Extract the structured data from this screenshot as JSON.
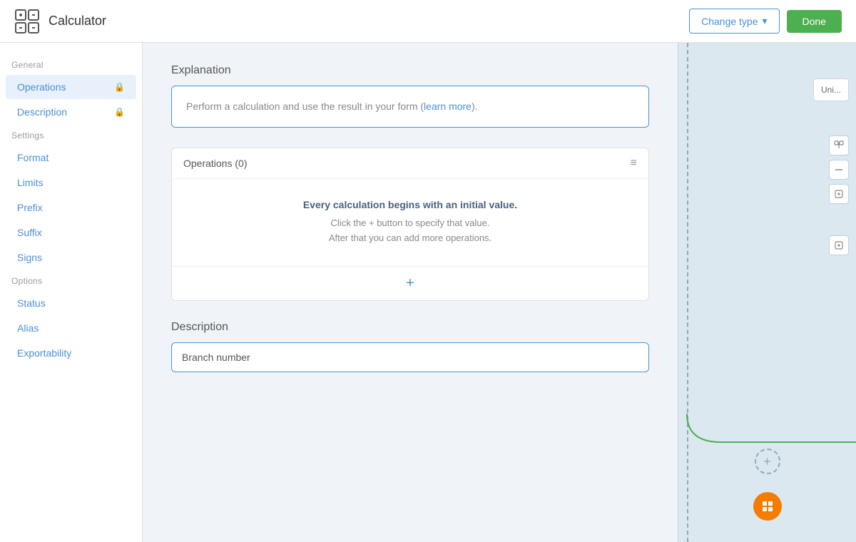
{
  "header": {
    "app_icon": "calculator-icon",
    "app_title": "Calculator",
    "change_type_label": "Change type",
    "done_label": "Done"
  },
  "sidebar": {
    "general_label": "General",
    "settings_label": "Settings",
    "options_label": "Options",
    "items_general": [
      {
        "id": "operations",
        "label": "Operations",
        "locked": true,
        "active": true
      },
      {
        "id": "description",
        "label": "Description",
        "locked": true,
        "active": false
      }
    ],
    "items_settings": [
      {
        "id": "format",
        "label": "Format",
        "locked": false
      },
      {
        "id": "limits",
        "label": "Limits",
        "locked": false
      },
      {
        "id": "prefix",
        "label": "Prefix",
        "locked": false
      },
      {
        "id": "suffix",
        "label": "Suffix",
        "locked": false
      },
      {
        "id": "signs",
        "label": "Signs",
        "locked": false
      }
    ],
    "items_options": [
      {
        "id": "status",
        "label": "Status",
        "locked": false
      },
      {
        "id": "alias",
        "label": "Alias",
        "locked": false
      },
      {
        "id": "exportability",
        "label": "Exportability",
        "locked": false
      }
    ]
  },
  "main": {
    "explanation_section": {
      "title": "Explanation",
      "text_before_link": "Perform a calculation and use the result in your form (",
      "link_text": "learn more",
      "text_after_link": ")."
    },
    "operations_section": {
      "header_title": "Operations (0)",
      "body_title": "Every calculation begins with an initial value.",
      "body_line1": "Click the + button to specify that value.",
      "body_line2": "After that you can add more operations."
    },
    "description_section": {
      "title": "Description",
      "input_placeholder": "Branch number",
      "input_value": "Branch number"
    }
  },
  "right_panel": {
    "node_label": "Uni..."
  },
  "colors": {
    "accent_blue": "#4a90d9",
    "done_green": "#4caf50",
    "orange": "#f57c00",
    "active_bg": "#e8f0fb"
  }
}
